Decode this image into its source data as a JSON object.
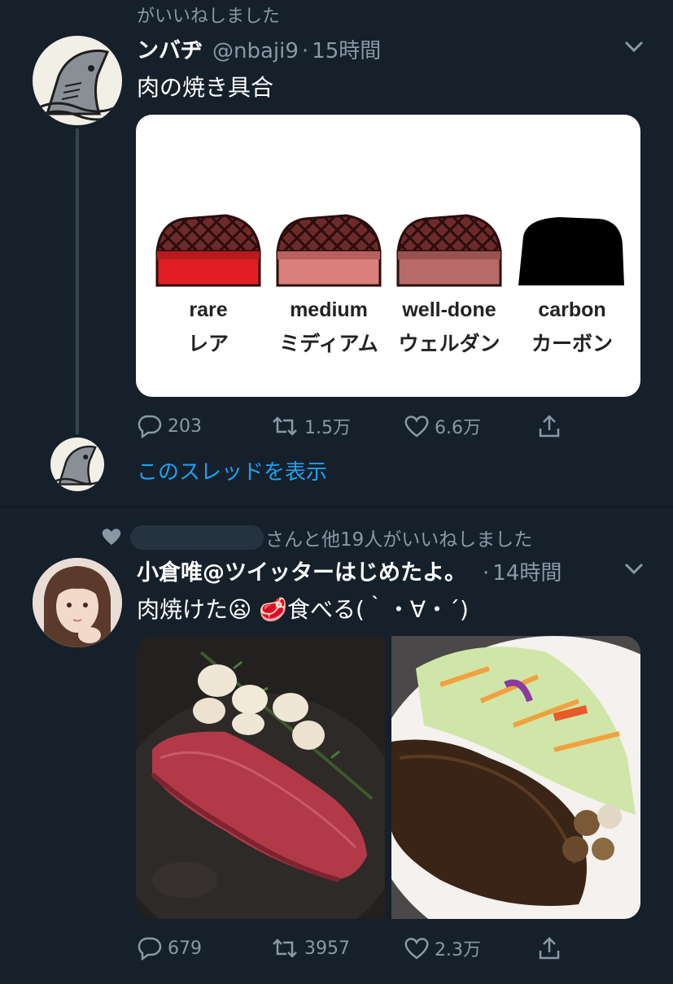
{
  "tweet1": {
    "context": "がいいねしました",
    "name": "ンバヂ",
    "handle": "@nbaji9",
    "dot": "·",
    "time": "15時間",
    "text": "肉の焼き具合",
    "card": {
      "items": [
        {
          "en": "rare",
          "jp": "レア"
        },
        {
          "en": "medium",
          "jp": "ミディアム"
        },
        {
          "en": "well-done",
          "jp": "ウェルダン"
        },
        {
          "en": "carbon",
          "jp": "カーボン"
        }
      ]
    },
    "actions": {
      "reply": "203",
      "retweet": "1.5万",
      "like": "6.6万"
    },
    "show_thread": "このスレッドを表示"
  },
  "tweet2": {
    "context": "さんと他19人がいいねしました",
    "name": "小倉唯@ツイッターはじめたよ。",
    "dot": "·",
    "time": "14時間",
    "text": "肉焼けた😦 🥩食べる(｀・∀・´)",
    "actions": {
      "reply": "679",
      "retweet": "3957",
      "like": "2.3万"
    }
  },
  "colors": {
    "background": "#15202b",
    "muted": "#8899a6",
    "link": "#1da1f2",
    "line": "#38444d"
  }
}
